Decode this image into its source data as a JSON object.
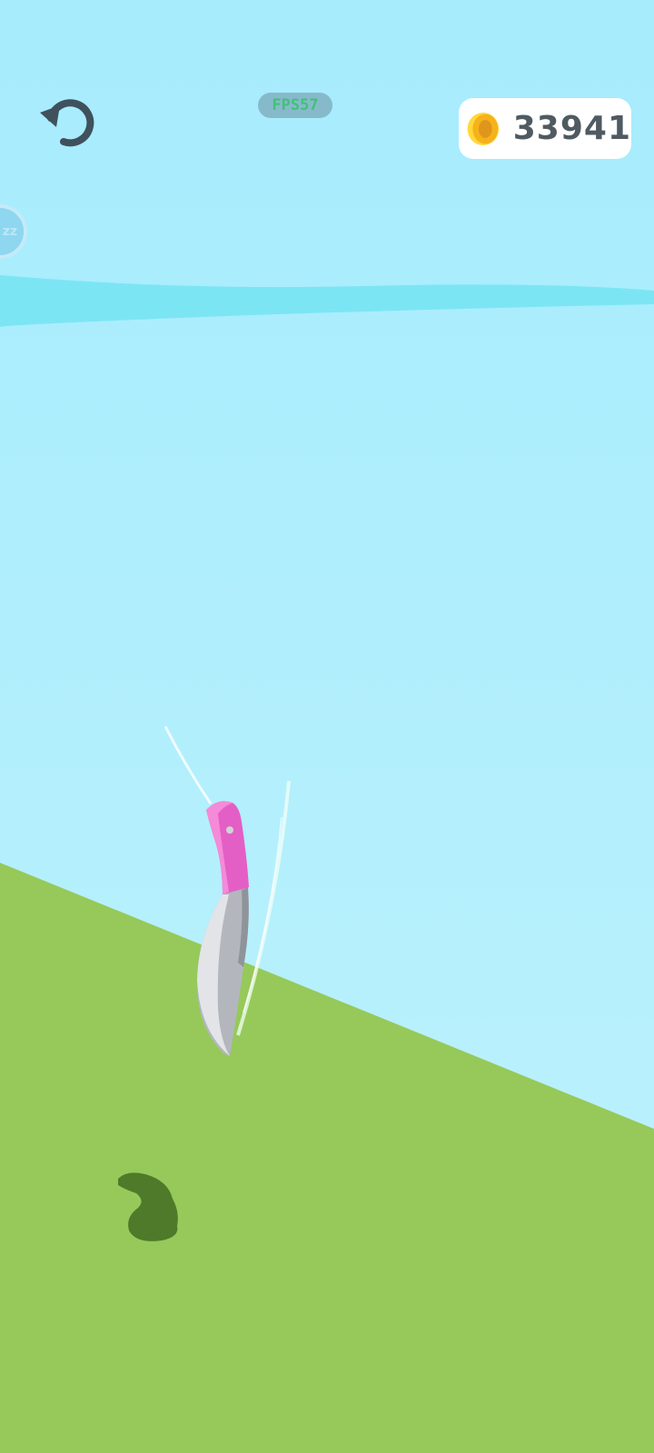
{
  "hud": {
    "fps_label": "FPS57",
    "coins": "33941",
    "sleep_badge": "zz"
  },
  "icons": {
    "restart": "restart-icon",
    "coin": "coin-icon",
    "sleep": "sleep-icon"
  },
  "colors": {
    "sky_top": "#a6ecfd",
    "sky_bottom": "#c0f2fd",
    "water": "#7ce5f4",
    "grass": "#96c95a",
    "knife_handle": "#e35fc6",
    "knife_blade": "#b3b7bd",
    "icon_dark": "#3f515d",
    "fps_text": "#43c07a",
    "coin_gold": "#f5b21b"
  }
}
